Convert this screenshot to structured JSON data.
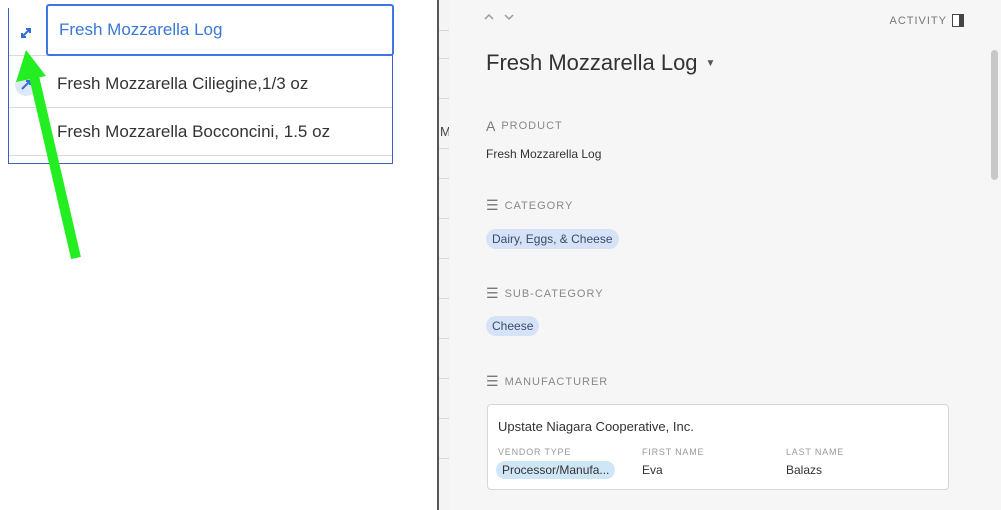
{
  "table": {
    "rows": [
      {
        "name": "Fresh Mozzarella Log"
      },
      {
        "name": "Fresh Mozzarella Ciliegine,1/3 oz"
      },
      {
        "name": "Fresh Mozzarella Bocconcini, 1.5 oz"
      }
    ]
  },
  "grid_strip": {
    "mark": "M"
  },
  "panel": {
    "activity_label": "ACTIVITY",
    "title": "Fresh Mozzarella Log",
    "fields": {
      "product": {
        "label": "PRODUCT",
        "icon_glyph": "A",
        "value": "Fresh Mozzarella Log"
      },
      "category": {
        "label": "CATEGORY",
        "icon_glyph": "☰",
        "value": "Dairy, Eggs, & Cheese"
      },
      "sub_category": {
        "label": "SUB-CATEGORY",
        "icon_glyph": "☰",
        "value": "Cheese"
      },
      "manufacturer": {
        "label": "MANUFACTURER",
        "icon_glyph": "☰",
        "name": "Upstate Niagara Cooperative, Inc.",
        "columns": {
          "vendor_type": {
            "label": "VENDOR TYPE",
            "value": "Processor/Manufa..."
          },
          "first_name": {
            "label": "FIRST NAME",
            "value": "Eva"
          },
          "last_name": {
            "label": "LAST NAME",
            "value": "Balazs"
          }
        }
      }
    }
  },
  "colors": {
    "arrow": "#22ee22",
    "active_border": "#3f76e0",
    "link_text": "#3a78d4",
    "chip_bg": "#d6e2f7"
  }
}
